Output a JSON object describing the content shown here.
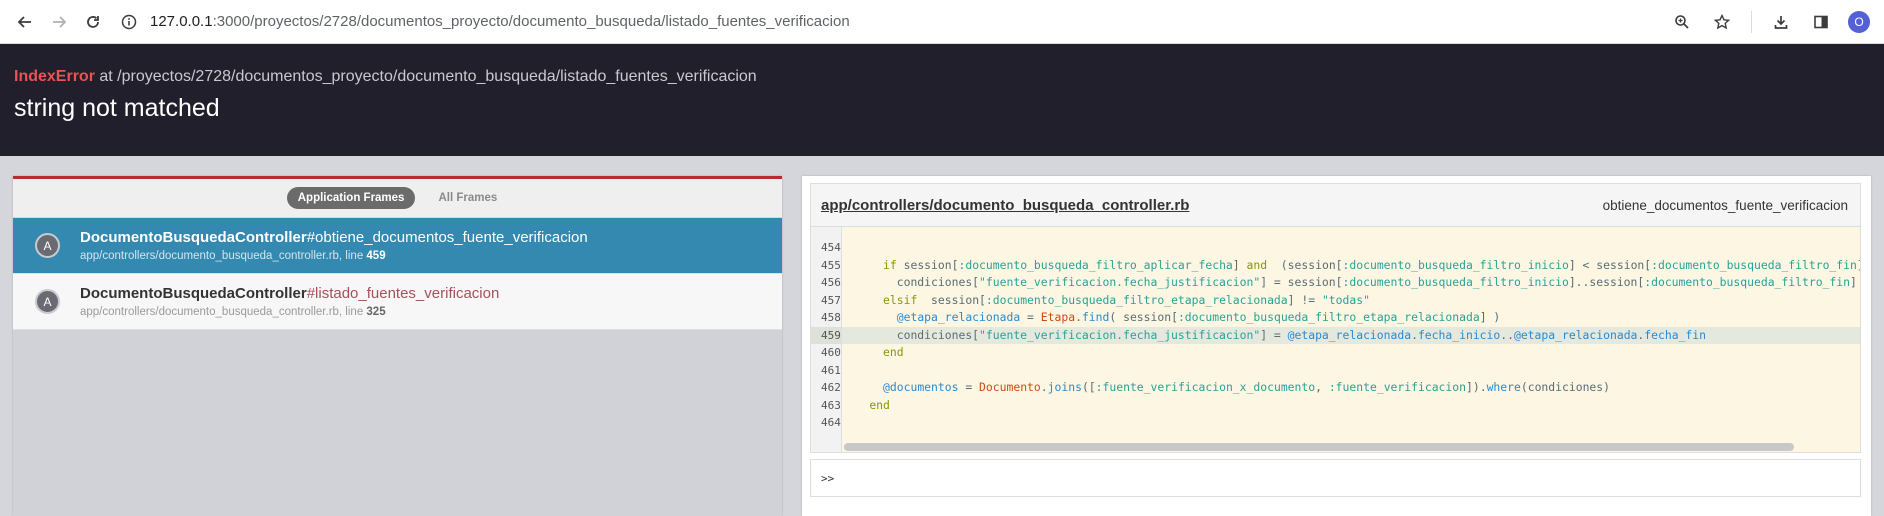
{
  "browser": {
    "url_host": "127.0.0.1",
    "url_path": ":3000/proyectos/2728/documentos_proyecto/documento_busqueda/listado_fuentes_verificacion",
    "profile_initial": "O"
  },
  "error": {
    "exception": "IndexError",
    "at_text": " at /proyectos/2728/documentos_proyecto/documento_busqueda/listado_fuentes_verificacion",
    "message": "string not matched"
  },
  "frames": {
    "tabs": [
      "Application Frames",
      "All Frames"
    ],
    "items": [
      {
        "badge": "A",
        "class_name": "DocumentoBusquedaController",
        "method": "#obtiene_documentos_fuente_verificacion",
        "file": "app/controllers/documento_busqueda_controller.rb, line ",
        "line": "459"
      },
      {
        "badge": "A",
        "class_name": "DocumentoBusquedaController",
        "method": "#listado_fuentes_verificacion",
        "file": "app/controllers/documento_busqueda_controller.rb, line ",
        "line": "325"
      }
    ]
  },
  "code": {
    "file": "app/controllers/documento_busqueda_controller.rb",
    "method": "obtiene_documentos_fuente_verificacion",
    "line_numbers": [
      "454",
      "455",
      "456",
      "457",
      "458",
      "459",
      "460",
      "461",
      "462",
      "463",
      "464"
    ],
    "highlight_line": "459",
    "console_prompt": ">>"
  }
}
